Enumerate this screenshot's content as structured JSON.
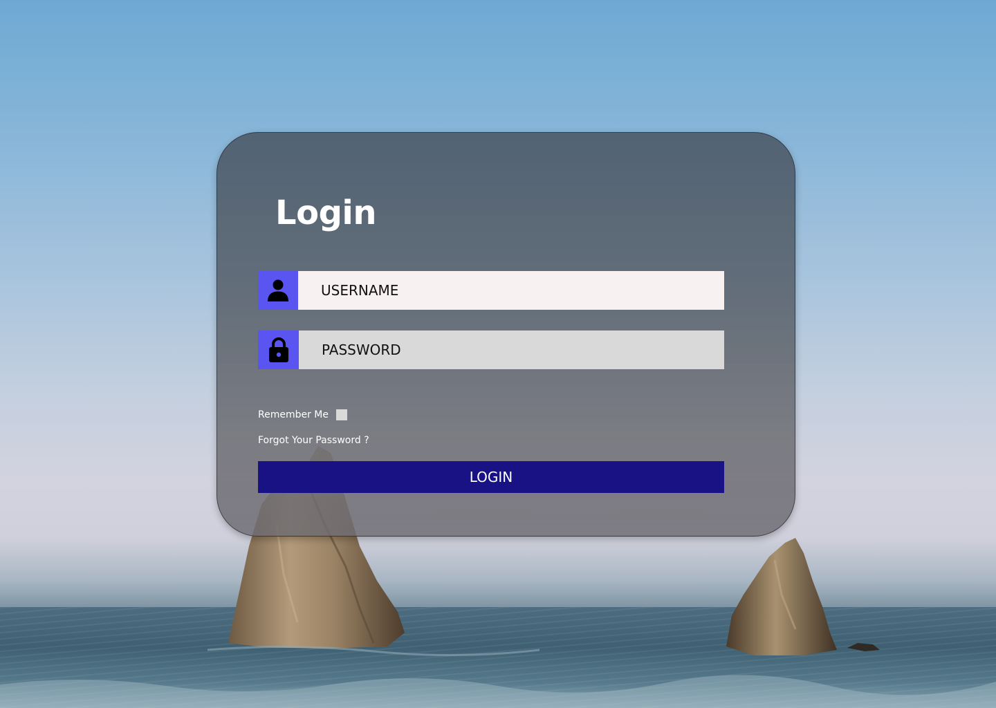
{
  "login_card": {
    "title": "Login",
    "username": {
      "placeholder": "USERNAME",
      "value": "",
      "icon": "user-icon"
    },
    "password": {
      "placeholder": "PASSWORD",
      "value": "",
      "icon": "lock-icon"
    },
    "remember_label": "Remember Me",
    "remember_checked": false,
    "forgot_label": "Forgot Your Password ?",
    "login_label": "LOGIN"
  },
  "colors": {
    "accent": "#5a55f0",
    "button": "#181284",
    "username_bg": "#f7f1f1",
    "password_bg": "#d9d9d9",
    "checkbox": "#d9d9d9"
  }
}
